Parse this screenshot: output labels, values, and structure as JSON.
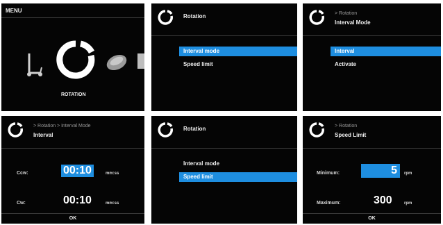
{
  "screens": {
    "menu": {
      "title": "MENU",
      "caption": "ROTATION"
    },
    "rotation_menu_1": {
      "title": "Rotation",
      "items": [
        {
          "label": "Interval mode",
          "selected": true
        },
        {
          "label": "Speed limit",
          "selected": false
        }
      ]
    },
    "interval_mode_menu": {
      "breadcrumb": "> Rotation",
      "title": "Interval Mode",
      "items": [
        {
          "label": "Interval",
          "selected": true
        },
        {
          "label": "Activate",
          "selected": false
        }
      ]
    },
    "interval_edit": {
      "breadcrumb": "> Rotation > Interval Mode",
      "title": "Interval",
      "rows": [
        {
          "label": "Ccw:",
          "value": "00:10",
          "unit": "mm:ss",
          "selected": true
        },
        {
          "label": "Cw:",
          "value": "00:10",
          "unit": "mm:ss",
          "selected": false
        }
      ],
      "ok": "OK"
    },
    "rotation_menu_2": {
      "title": "Rotation",
      "items": [
        {
          "label": "Interval mode",
          "selected": false
        },
        {
          "label": "Speed limit",
          "selected": true
        }
      ]
    },
    "speed_limit_edit": {
      "breadcrumb": "> Rotation",
      "title": "Speed Limit",
      "rows": [
        {
          "label": "Minimum:",
          "value": "5",
          "unit": "rpm",
          "selected": true
        },
        {
          "label": "Maximum:",
          "value": "300",
          "unit": "rpm",
          "selected": false
        }
      ],
      "ok": "OK"
    }
  },
  "colors": {
    "selection": "#1e8ee0",
    "background": "#050505"
  },
  "icons": [
    "rotation-icon",
    "shaker-icon",
    "tilt-icon",
    "device-icon"
  ]
}
